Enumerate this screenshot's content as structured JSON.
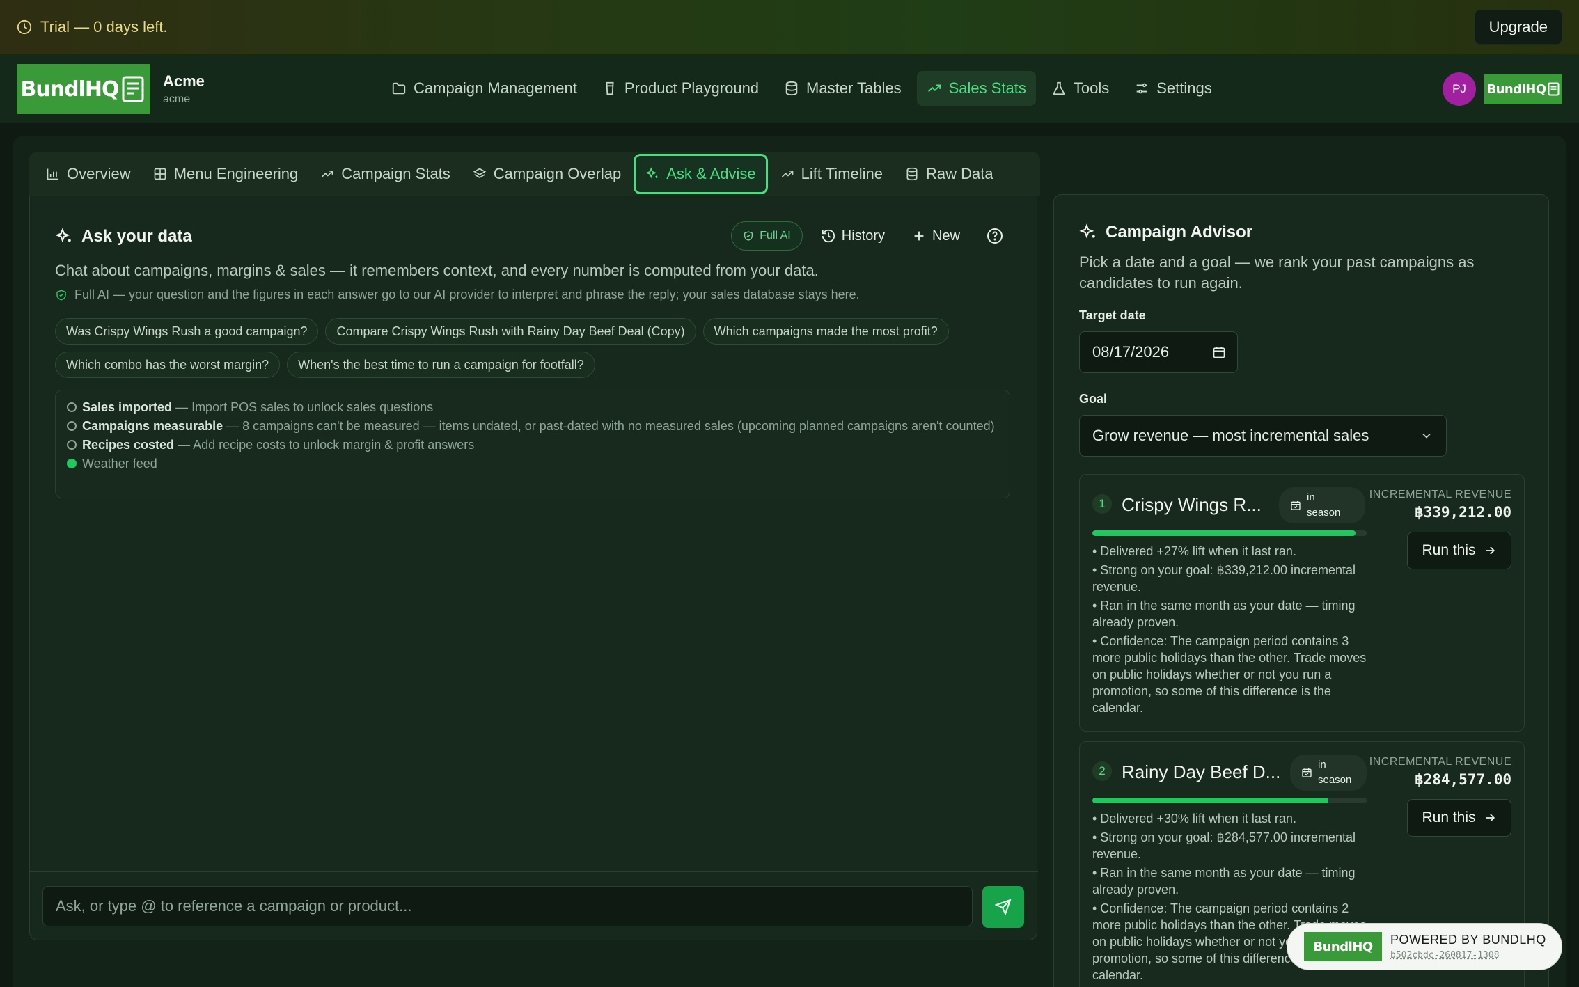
{
  "trial": {
    "text": "Trial — 0 days left.",
    "upgrade_label": "Upgrade"
  },
  "brand": {
    "logo_text": "BundlHQ",
    "org_name": "Acme",
    "org_slug": "acme",
    "avatar_initials": "PJ",
    "accent": "#4ade80",
    "brand_green": "#3a9a3a"
  },
  "nav": {
    "items": [
      {
        "label": "Campaign Management",
        "icon": "folder-icon"
      },
      {
        "label": "Product Playground",
        "icon": "cup-icon"
      },
      {
        "label": "Master Tables",
        "icon": "database-icon"
      },
      {
        "label": "Sales Stats",
        "icon": "trending-up-icon",
        "active": true
      },
      {
        "label": "Tools",
        "icon": "flask-icon"
      },
      {
        "label": "Settings",
        "icon": "sliders-icon"
      }
    ]
  },
  "tabs": [
    {
      "label": "Overview",
      "icon": "bar-chart-icon"
    },
    {
      "label": "Menu Engineering",
      "icon": "grid-icon"
    },
    {
      "label": "Campaign Stats",
      "icon": "trending-up-icon"
    },
    {
      "label": "Campaign Overlap",
      "icon": "layers-icon"
    },
    {
      "label": "Ask & Advise",
      "icon": "sparkles-icon",
      "active": true
    },
    {
      "label": "Lift Timeline",
      "icon": "trending-up-icon"
    },
    {
      "label": "Raw Data",
      "icon": "database-icon"
    }
  ],
  "chat": {
    "title": "Ask your data",
    "badge": "Full AI",
    "history_label": "History",
    "new_label": "New",
    "subtitle": "Chat about campaigns, margins & sales — it remembers context, and every number is computed from your data.",
    "note": "Full AI — your question and the figures in each answer go to our AI provider to interpret and phrase the reply; your sales database stays here.",
    "suggestions": [
      "Was Crispy Wings Rush a good campaign?",
      "Compare Crispy Wings Rush with Rainy Day Beef Deal (Copy)",
      "Which campaigns made the most profit?",
      "Which combo has the worst margin?",
      "When's the best time to run a campaign for footfall?"
    ],
    "status": [
      {
        "title": "Sales imported",
        "desc": "— Import POS sales to unlock sales questions",
        "done": false
      },
      {
        "title": "Campaigns measurable",
        "desc": "— 8 campaigns can't be measured — items undated, or past-dated with no measured sales (upcoming planned campaigns aren't counted)",
        "done": false
      },
      {
        "title": "Recipes costed",
        "desc": "— Add recipe costs to unlock margin & profit answers",
        "done": false
      },
      {
        "title": "Weather feed",
        "desc": "",
        "done": true
      }
    ],
    "input_placeholder": "Ask, or type @ to reference a campaign or product..."
  },
  "advisor": {
    "title": "Campaign Advisor",
    "subtitle": "Pick a date and a goal — we rank your past campaigns as candidates to run again.",
    "target_date_label": "Target date",
    "target_date": "08/17/2026",
    "goal_label": "Goal",
    "goal_value": "Grow revenue — most incremental sales",
    "campaigns": [
      {
        "rank": "1",
        "name": "Crispy Wings R...",
        "season_line1": "in",
        "season_line2": "season",
        "metric_label": "INCREMENTAL REVENUE",
        "metric_value": "฿339,212.00",
        "progress": 0.96,
        "run_label": "Run this",
        "bullets": [
          "• Delivered +27% lift when it last ran.",
          "• Strong on your goal: ฿339,212.00 incremental revenue.",
          "• Ran in the same month as your date — timing already proven.",
          "• Confidence: The campaign period contains 3 more public holidays than the other. Trade moves on public holidays whether or not you run a promotion, so some of this difference is the calendar."
        ]
      },
      {
        "rank": "2",
        "name": "Rainy Day Beef D...",
        "season_line1": "in",
        "season_line2": "season",
        "metric_label": "INCREMENTAL REVENUE",
        "metric_value": "฿284,577.00",
        "progress": 0.86,
        "run_label": "Run this",
        "bullets": [
          "• Delivered +30% lift when it last ran.",
          "• Strong on your goal: ฿284,577.00 incremental revenue.",
          "• Ran in the same month as your date — timing already proven.",
          "• Confidence: The campaign period contains 2 more public holidays than the other. Trade moves on public holidays whether or not you run a promotion, so some of this difference is the calendar."
        ]
      }
    ]
  },
  "powered": {
    "text": "POWERED BY BUNDLHQ",
    "code": "b502cbdc-260817-1308"
  }
}
